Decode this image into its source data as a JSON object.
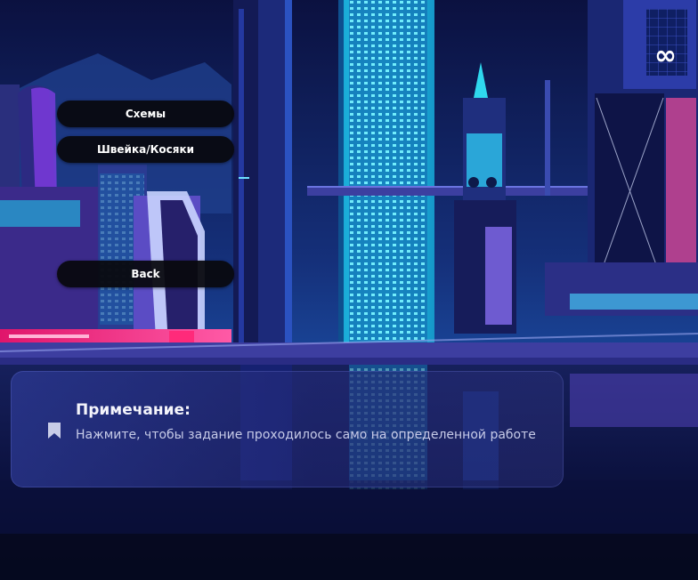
{
  "menu": {
    "schemes_label": "Схемы",
    "sewing_label": "Швейка/Косяки",
    "back_label": "Back"
  },
  "note": {
    "icon": "bookmark-icon",
    "title": "Примечание:",
    "text": "Нажмите, чтобы задание проходилось само на определенной работе"
  },
  "background": {
    "description_icon": "cityscape-illustration",
    "colors": {
      "sky_top": "#0b1140",
      "cyan": "#19d6f2",
      "magenta": "#e0156b",
      "purple": "#4b2fa8"
    }
  }
}
